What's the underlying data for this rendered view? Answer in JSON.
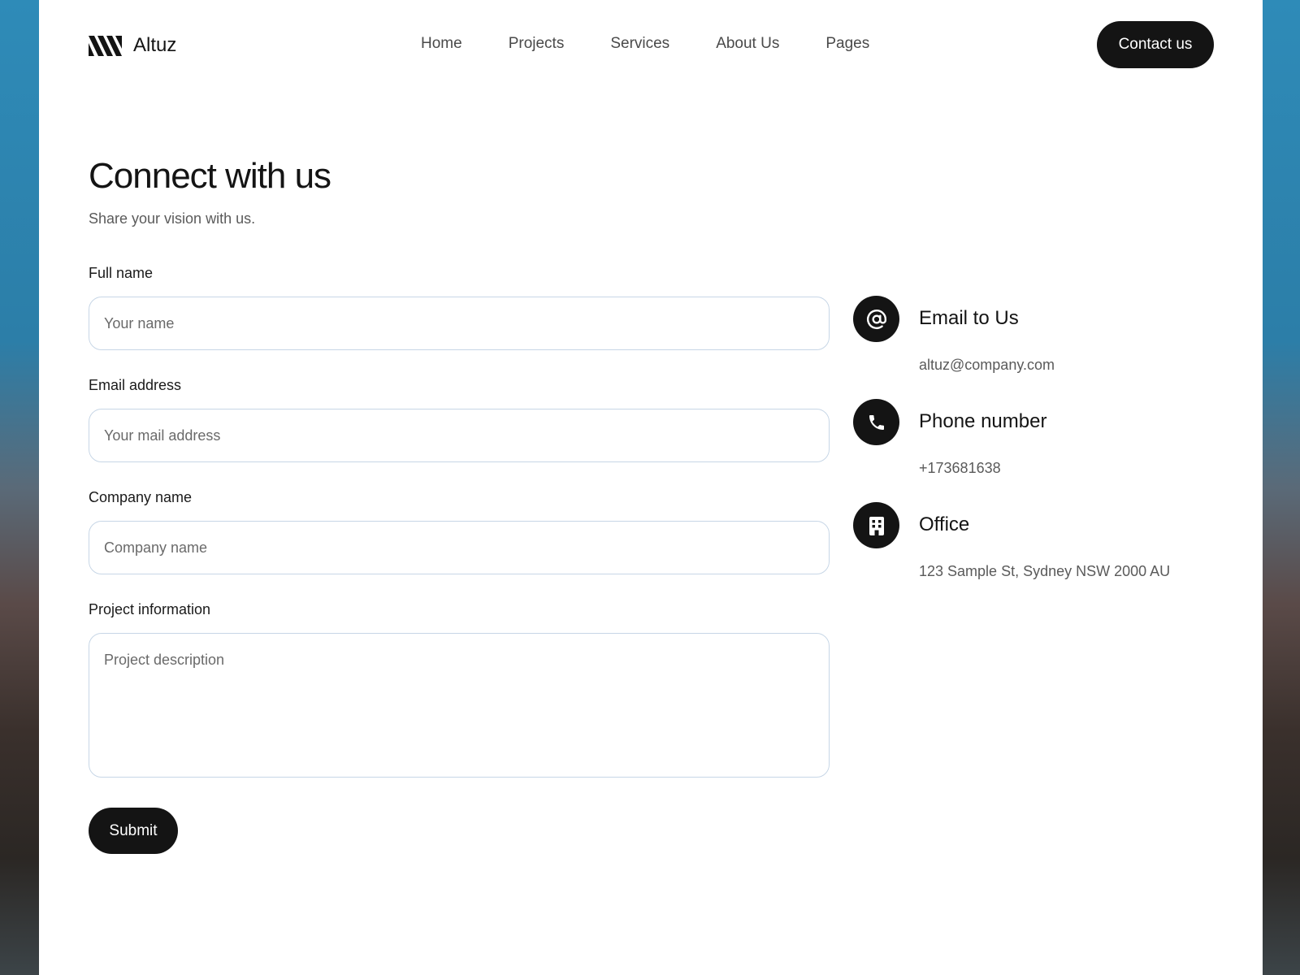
{
  "brand": {
    "name": "Altuz"
  },
  "nav": {
    "items": [
      {
        "label": "Home"
      },
      {
        "label": "Projects"
      },
      {
        "label": "Services"
      },
      {
        "label": "About Us"
      },
      {
        "label": "Pages"
      }
    ],
    "cta_label": "Contact us"
  },
  "main": {
    "title": "Connect with us",
    "subtitle": "Share your vision with us."
  },
  "form": {
    "full_name": {
      "label": "Full name",
      "placeholder": "Your name",
      "value": ""
    },
    "email": {
      "label": "Email address",
      "placeholder": "Your mail address",
      "value": ""
    },
    "company": {
      "label": "Company name",
      "placeholder": "Company name",
      "value": ""
    },
    "project": {
      "label": "Project information",
      "placeholder": "Project description",
      "value": ""
    },
    "submit_label": "Submit"
  },
  "contact_info": {
    "email": {
      "icon": "at-icon",
      "title": "Email to Us",
      "value": "altuz@company.com"
    },
    "phone": {
      "icon": "phone-icon",
      "title": "Phone number",
      "value": "+173681638"
    },
    "office": {
      "icon": "building-icon",
      "title": "Office",
      "value": "123 Sample St, Sydney NSW 2000 AU"
    }
  },
  "colors": {
    "primary": "#141414",
    "input_border": "#c7d6e6",
    "muted_text": "#5a5a5a",
    "background": "#ffffff"
  }
}
